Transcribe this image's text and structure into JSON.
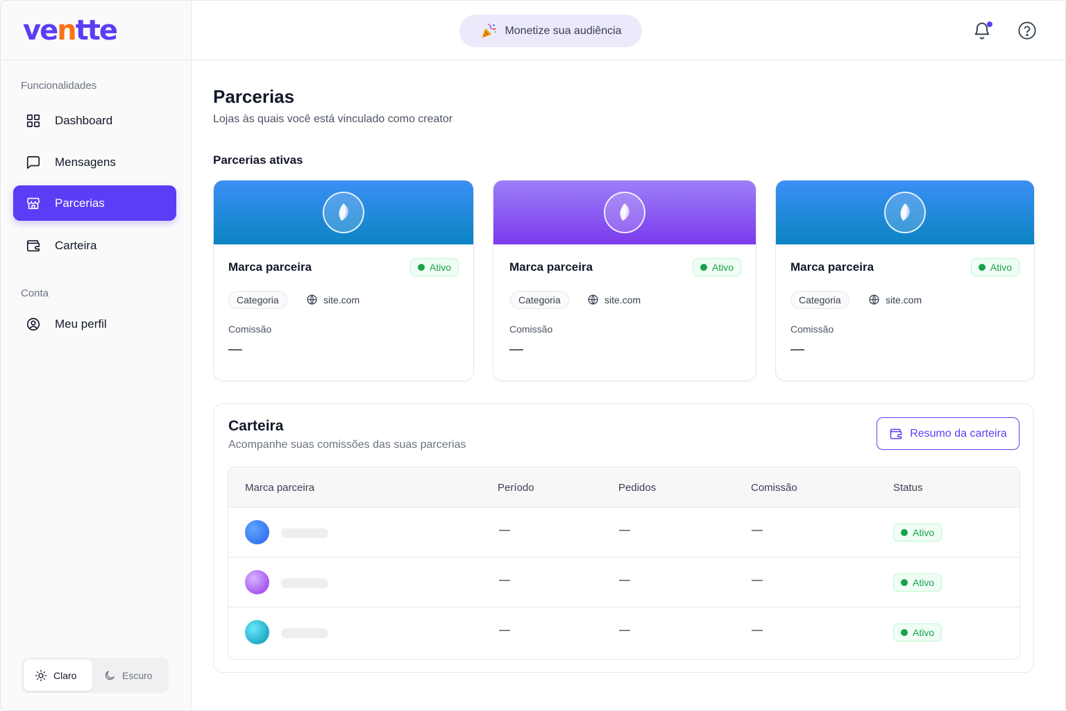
{
  "brand": {
    "logo_main": "ve",
    "logo_accent": "n",
    "logo_rest": "tte",
    "accent_color": "#5b3df5",
    "accent_secondary": "#f97316"
  },
  "header": {
    "promo_icon": "party-popper-icon",
    "promo_label": "Monetize sua audiência",
    "notification_icon": "bell-icon",
    "help_icon": "help-circle-icon"
  },
  "sidebar": {
    "section_features": "Funcionalidades",
    "items": [
      {
        "label": "Dashboard",
        "icon": "grid-icon"
      },
      {
        "label": "Mensagens",
        "icon": "message-square-icon"
      },
      {
        "label": "Parcerias",
        "icon": "store-icon",
        "active": true
      },
      {
        "label": "Carteira",
        "icon": "wallet-icon"
      }
    ],
    "section_account": "Conta",
    "account_items": [
      {
        "label": "Meu perfil",
        "icon": "user-circle-icon"
      }
    ],
    "theme": {
      "light": "Claro",
      "dark": "Escuro",
      "selected": "Claro"
    }
  },
  "page": {
    "title": "Parcerias",
    "subtitle": "Lojas às quais você está vinculado como creator",
    "active_section": "Parcerias ativas"
  },
  "partner_cards": [
    {
      "name": "Marca parceira",
      "status": "Ativo",
      "category": "Categoria",
      "site": "site.com",
      "commission_label": "Comissão",
      "commission_value": "—",
      "band": "blue"
    },
    {
      "name": "Marca parceira",
      "status": "Ativo",
      "category": "Categoria",
      "site": "site.com",
      "commission_label": "Comissão",
      "commission_value": "—",
      "band": "purple"
    },
    {
      "name": "Marca parceira",
      "status": "Ativo",
      "category": "Categoria",
      "site": "site.com",
      "commission_label": "Comissão",
      "commission_value": "—",
      "band": "blue"
    }
  ],
  "wallet": {
    "title": "Carteira",
    "subtitle": "Acompanhe suas comissões das suas parcerias",
    "button_label": "Resumo da carteira",
    "columns": [
      "Marca parceira",
      "Período",
      "Pedidos",
      "Comissão",
      "Status"
    ],
    "rows": [
      {
        "period": "—",
        "orders": "—",
        "commission": "—",
        "status": "Ativo",
        "avatar_color": "#3b82f6"
      },
      {
        "period": "—",
        "orders": "—",
        "commission": "—",
        "status": "Ativo",
        "avatar_color": "#a855f7"
      },
      {
        "period": "—",
        "orders": "—",
        "commission": "—",
        "status": "Ativo",
        "avatar_color": "#06b6d4"
      }
    ]
  }
}
